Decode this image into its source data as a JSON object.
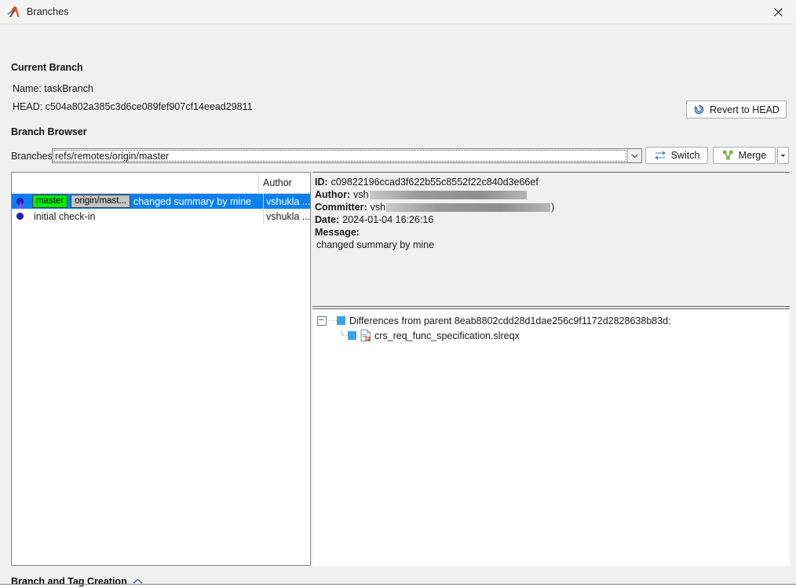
{
  "window": {
    "title": "Branches",
    "logo_icon": "matlab-membrane-icon",
    "close_icon": "close-icon"
  },
  "current_branch": {
    "heading": "Current Branch",
    "name_label": "Name: taskBranch",
    "head_label": "HEAD: c504a802a385c3d6ce089fef907cf14eead29811",
    "revert_button": "Revert to HEAD",
    "revert_icon": "revert-arrow-icon"
  },
  "branch_browser": {
    "heading": "Branch Browser",
    "branches_label": "Branches:",
    "branches_value": "refs/remotes/origin/master",
    "dropdown_icon": "chevron-down-icon",
    "switch_button": "Switch",
    "switch_icon": "switch-arrows-icon",
    "merge_button": "Merge",
    "merge_icon": "merge-branch-icon",
    "merge_dropdown_icon": "caret-down-icon"
  },
  "commit_list": {
    "columns": [
      "",
      "Author"
    ],
    "rows": [
      {
        "refs": [
          {
            "label": "master",
            "type": "local"
          },
          {
            "label": "origin/mast...",
            "type": "remote"
          }
        ],
        "summary": "changed summary by mine",
        "author": "vshukla ...",
        "selected": true,
        "has_edge_down": true
      },
      {
        "refs": [],
        "summary": "initial check-in",
        "author": "vshukla ...",
        "selected": false,
        "has_edge_down": false
      }
    ]
  },
  "details": {
    "id_label": "ID:",
    "id_value": "c09822196ccad3f622b55c8552f22c840d3e66ef",
    "author_label": "Author:",
    "author_value": "vsh",
    "author_redacted_width": 200,
    "author_suffix": "",
    "committer_label": "Committer:",
    "committer_value": "vsh",
    "committer_redacted_width": 209,
    "committer_suffix": ")",
    "date_label": "Date:",
    "date_value": "2024-01-04 16:26:16",
    "message_label": "Message:",
    "message_value": "changed summary by mine"
  },
  "differences": {
    "root_label": "Differences from parent 8eab8802cdd28d1dae256c9f1172d2828638b83d:",
    "files": [
      {
        "name": "crs_req_func_specification.slreqx",
        "icon": "slreqx-file-icon"
      }
    ]
  },
  "branch_tag_creation": {
    "heading": "Branch and Tag Creation",
    "collapse_icon": "chevron-up-icon"
  },
  "colors": {
    "selection_blue": "#0a80f0",
    "local_ref_green": "#00ee00",
    "remote_ref_gray": "#c4c4c4",
    "graph_node": "#2222cc",
    "graph_edge": "#ff22ff",
    "tree_square": "#3aa3e8"
  }
}
